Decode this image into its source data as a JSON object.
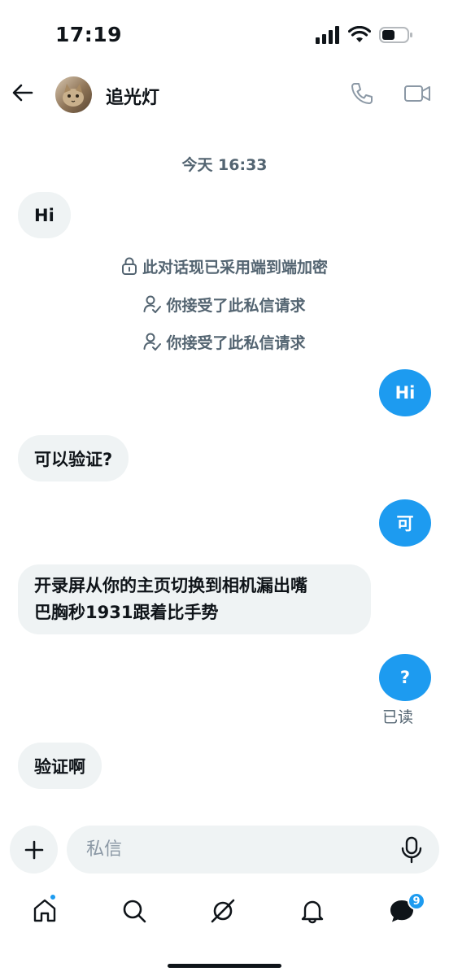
{
  "status_bar": {
    "time": "17:19"
  },
  "header": {
    "contact_name": "追光灯"
  },
  "conversation": {
    "date_divider": "今天 16:33",
    "messages": [
      {
        "id": "m1",
        "direction": "in",
        "text": "Hi"
      },
      {
        "id": "s1",
        "direction": "system",
        "icon": "lock-icon",
        "text": "此对话现已采用端到端加密"
      },
      {
        "id": "s2",
        "direction": "system",
        "icon": "person-check-icon",
        "text": "你接受了此私信请求"
      },
      {
        "id": "s3",
        "direction": "system",
        "icon": "person-check-icon",
        "text": "你接受了此私信请求"
      },
      {
        "id": "m2",
        "direction": "out",
        "text": "Hi"
      },
      {
        "id": "m3",
        "direction": "in",
        "text": "可以验证?"
      },
      {
        "id": "m4",
        "direction": "out",
        "text": "可"
      },
      {
        "id": "m5",
        "direction": "in",
        "lines": [
          "开录屏从你的主页切换到相机漏出嘴",
          "巴胸秒1931跟着比手势"
        ]
      },
      {
        "id": "m6",
        "direction": "out",
        "text": "?"
      },
      {
        "id": "m7",
        "direction": "in",
        "text": "验证啊"
      }
    ],
    "read_receipt": "已读"
  },
  "composer": {
    "placeholder": "私信"
  },
  "tab_bar": {
    "tabs": [
      "home-icon",
      "search-icon",
      "grok-icon",
      "bell-icon",
      "messages-icon"
    ],
    "messages_badge": "9"
  },
  "colors": {
    "accent": "#1d9bf0",
    "bubble_in": "#eff3f4",
    "text_primary": "#0f1419",
    "text_secondary": "#536471"
  }
}
